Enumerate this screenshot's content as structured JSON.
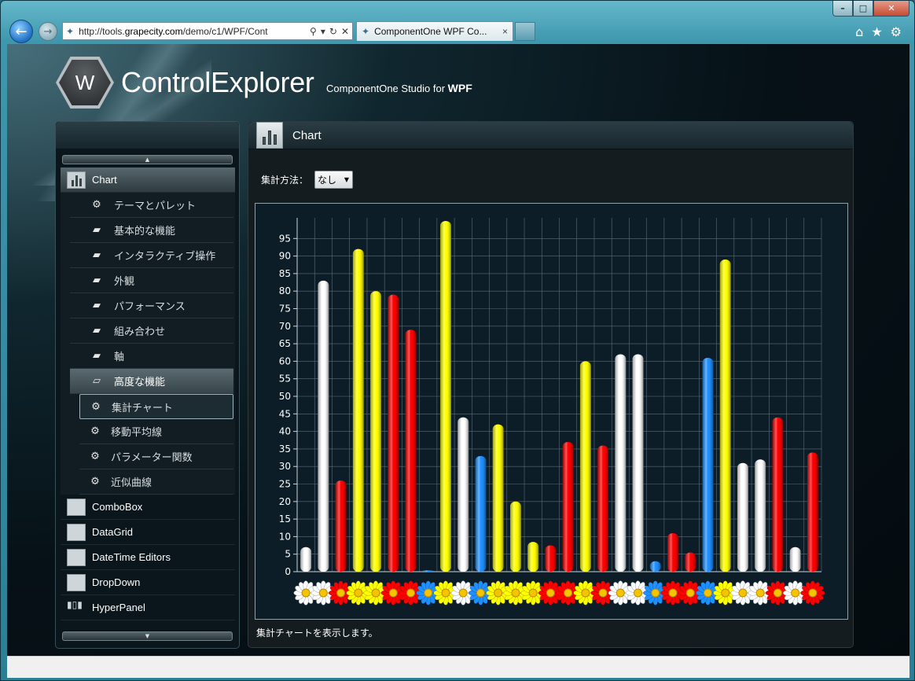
{
  "browser": {
    "url_prefix": "http://tools.",
    "url_domain": "grapecity.com",
    "url_suffix": "/demo/c1/WPF/Cont",
    "tab_title": "ComponentOne WPF Co...",
    "tab_close": "×"
  },
  "header": {
    "logo_letter": "W",
    "title": "ControlExplorer",
    "subtitle_prefix": "ComponentOne Studio for ",
    "subtitle_bold": "WPF"
  },
  "sidebar": {
    "top_category": "Chart",
    "groups": [
      {
        "label": "テーマとパレット",
        "icon": "gear-icon"
      },
      {
        "label": "基本的な機能",
        "icon": "folder-icon"
      },
      {
        "label": "インタラクティブ操作",
        "icon": "folder-icon"
      },
      {
        "label": "外観",
        "icon": "folder-icon"
      },
      {
        "label": "パフォーマンス",
        "icon": "folder-icon"
      },
      {
        "label": "組み合わせ",
        "icon": "folder-icon"
      },
      {
        "label": "軸",
        "icon": "folder-icon"
      },
      {
        "label": "高度な機能",
        "icon": "folder-open-icon"
      }
    ],
    "advanced_items": [
      {
        "label": "集計チャート"
      },
      {
        "label": "移動平均線"
      },
      {
        "label": "パラメーター関数"
      },
      {
        "label": "近似曲線"
      }
    ],
    "controls": [
      {
        "label": "ComboBox"
      },
      {
        "label": "DataGrid"
      },
      {
        "label": "DateTime Editors"
      },
      {
        "label": "DropDown"
      },
      {
        "label": "HyperPanel"
      }
    ]
  },
  "content": {
    "title": "Chart",
    "aggregate_label": "集計方法：",
    "aggregate_value": "なし",
    "description": "集計チャートを表示します。"
  },
  "colors": {
    "white": "#ffffff",
    "yellow": "#ffff00",
    "red": "#ff0000",
    "blue": "#1e90ff",
    "gridline": "#5b6d7a",
    "chart_bg": "#0c1d28"
  },
  "chart_data": {
    "type": "bar",
    "ylim": [
      0,
      100
    ],
    "yticks": [
      0,
      5,
      10,
      15,
      20,
      25,
      30,
      35,
      40,
      45,
      50,
      55,
      60,
      65,
      70,
      75,
      80,
      85,
      90,
      95
    ],
    "grid": true,
    "x_labels": "flower-icons",
    "bars": [
      {
        "value": 7,
        "color": "white"
      },
      {
        "value": 83,
        "color": "white"
      },
      {
        "value": 26,
        "color": "red"
      },
      {
        "value": 92,
        "color": "yellow"
      },
      {
        "value": 80,
        "color": "yellow"
      },
      {
        "value": 79,
        "color": "red"
      },
      {
        "value": 69,
        "color": "red"
      },
      {
        "value": 0.4,
        "color": "blue"
      },
      {
        "value": 100,
        "color": "yellow"
      },
      {
        "value": 44,
        "color": "white"
      },
      {
        "value": 33,
        "color": "blue"
      },
      {
        "value": 42,
        "color": "yellow"
      },
      {
        "value": 20,
        "color": "yellow"
      },
      {
        "value": 8.5,
        "color": "yellow"
      },
      {
        "value": 7.5,
        "color": "red"
      },
      {
        "value": 37,
        "color": "red"
      },
      {
        "value": 60,
        "color": "yellow"
      },
      {
        "value": 36,
        "color": "red"
      },
      {
        "value": 62,
        "color": "white"
      },
      {
        "value": 62,
        "color": "white"
      },
      {
        "value": 3,
        "color": "blue"
      },
      {
        "value": 11,
        "color": "red"
      },
      {
        "value": 5.5,
        "color": "red"
      },
      {
        "value": 61,
        "color": "blue"
      },
      {
        "value": 89,
        "color": "yellow"
      },
      {
        "value": 31,
        "color": "white"
      },
      {
        "value": 32,
        "color": "white"
      },
      {
        "value": 44,
        "color": "red"
      },
      {
        "value": 7,
        "color": "white"
      },
      {
        "value": 34,
        "color": "red"
      }
    ]
  }
}
